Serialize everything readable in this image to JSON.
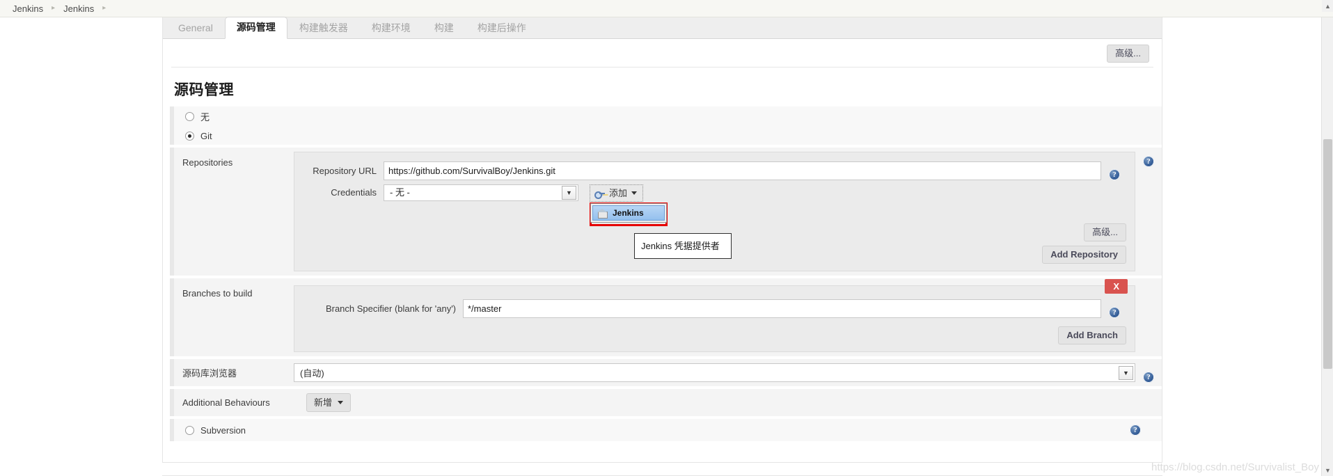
{
  "breadcrumb": {
    "items": [
      {
        "label": "Jenkins"
      },
      {
        "label": "Jenkins"
      }
    ],
    "separator": "▸"
  },
  "tabs": [
    {
      "label": "General",
      "active": false
    },
    {
      "label": "源码管理",
      "active": true
    },
    {
      "label": "构建触发器",
      "active": false
    },
    {
      "label": "构建环境",
      "active": false
    },
    {
      "label": "构建",
      "active": false
    },
    {
      "label": "构建后操作",
      "active": false
    }
  ],
  "toolbar": {
    "advanced_label": "高级..."
  },
  "scm": {
    "title": "源码管理",
    "options": [
      {
        "label": "无",
        "checked": false
      },
      {
        "label": "Git",
        "checked": true
      },
      {
        "label": "Subversion",
        "checked": false
      }
    ]
  },
  "repositories": {
    "label": "Repositories",
    "url_label": "Repository URL",
    "url_value": "https://github.com/SurvivalBoy/Jenkins.git",
    "credentials_label": "Credentials",
    "credentials_value": "- 无 -",
    "add_button_label": "添加",
    "menu_items": [
      {
        "label": "Jenkins",
        "icon": "jenkins-house-icon"
      }
    ],
    "tooltip_text": "Jenkins 凭据提供者",
    "advanced_label": "高级...",
    "add_repository_label": "Add Repository"
  },
  "branches": {
    "label": "Branches to build",
    "specifier_label": "Branch Specifier (blank for 'any')",
    "specifier_value": "*/master",
    "delete_label": "X",
    "add_branch_label": "Add Branch"
  },
  "repo_browser": {
    "label": "源码库浏览器",
    "value": "(自动)"
  },
  "additional_behaviours": {
    "label": "Additional Behaviours",
    "button_label": "新增"
  },
  "icons": {
    "help": "?",
    "chevron_down": "▼",
    "scroll_up": "▲",
    "scroll_down": "▼"
  },
  "watermark": {
    "text": "https://blog.csdn.net/Survivalist_Boy"
  },
  "colors": {
    "accent_red": "#e60000",
    "delete_red": "#d9534f",
    "help_blue": "#39629c",
    "menu_highlight": "#94c0ee"
  }
}
